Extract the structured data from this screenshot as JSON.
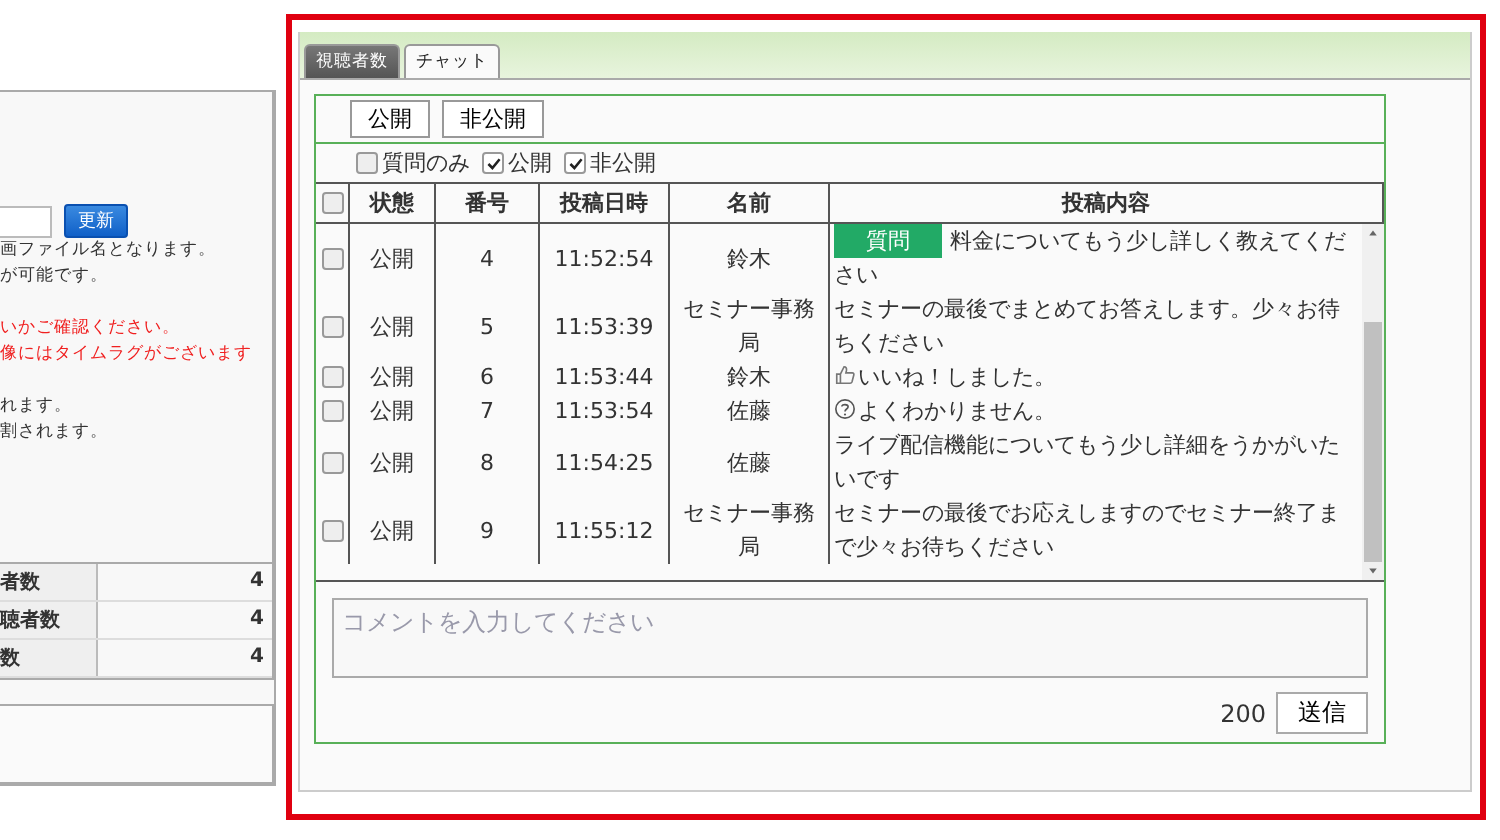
{
  "left_panel": {
    "update_button": "更新",
    "notes": [
      {
        "text": "画ファイル名となります。",
        "warning": false
      },
      {
        "text": "が可能です。",
        "warning": false
      },
      {
        "text": "いかご確認ください。",
        "warning": true
      },
      {
        "text": "像にはタイムラグがございます",
        "warning": true
      },
      {
        "text": "れます。",
        "warning": false
      },
      {
        "text": "割されます。",
        "warning": false
      }
    ],
    "stats": [
      {
        "label": "者数",
        "value": "4"
      },
      {
        "label": "聴者数",
        "value": "4"
      },
      {
        "label": "数",
        "value": "4"
      }
    ]
  },
  "tabs": [
    {
      "label": "視聴者数",
      "selected": false
    },
    {
      "label": "チャット",
      "selected": true
    }
  ],
  "status_buttons": [
    "公開",
    "非公開"
  ],
  "filters": [
    {
      "label": "質問のみ",
      "checked": false
    },
    {
      "label": "公開",
      "checked": true
    },
    {
      "label": "非公開",
      "checked": true
    }
  ],
  "table": {
    "select_all_checked": false,
    "columns": [
      "状態",
      "番号",
      "投稿日時",
      "名前",
      "投稿内容"
    ],
    "rows": [
      {
        "checked": false,
        "status": "公開",
        "number": "4",
        "time": "11:52:54",
        "name": "鈴木",
        "kind": "tagged",
        "tag": "質問",
        "content": "料金についてもう少し詳しく教えてください"
      },
      {
        "checked": false,
        "status": "公開",
        "number": "5",
        "time": "11:53:39",
        "name": "セミナー事務局",
        "kind": "text",
        "content": "セミナーの最後でまとめてお答えします。少々お待ちください"
      },
      {
        "checked": false,
        "status": "公開",
        "number": "6",
        "time": "11:53:44",
        "name": "鈴木",
        "kind": "like",
        "content": "いいね！しました。"
      },
      {
        "checked": false,
        "status": "公開",
        "number": "7",
        "time": "11:53:54",
        "name": "佐藤",
        "kind": "puzzled",
        "content": "よくわかりません。"
      },
      {
        "checked": false,
        "status": "公開",
        "number": "8",
        "time": "11:54:25",
        "name": "佐藤",
        "kind": "text",
        "content": "ライブ配信機能についてもう少し詳細をうかがいたいです"
      },
      {
        "checked": false,
        "status": "公開",
        "number": "9",
        "time": "11:55:12",
        "name": "セミナー事務局",
        "kind": "text",
        "content": "セミナーの最後でお応えしますのでセミナー終了まで少々お待ちください"
      }
    ]
  },
  "comment": {
    "placeholder": "コメントを入力してください",
    "remaining": "200",
    "send_button": "送信"
  }
}
